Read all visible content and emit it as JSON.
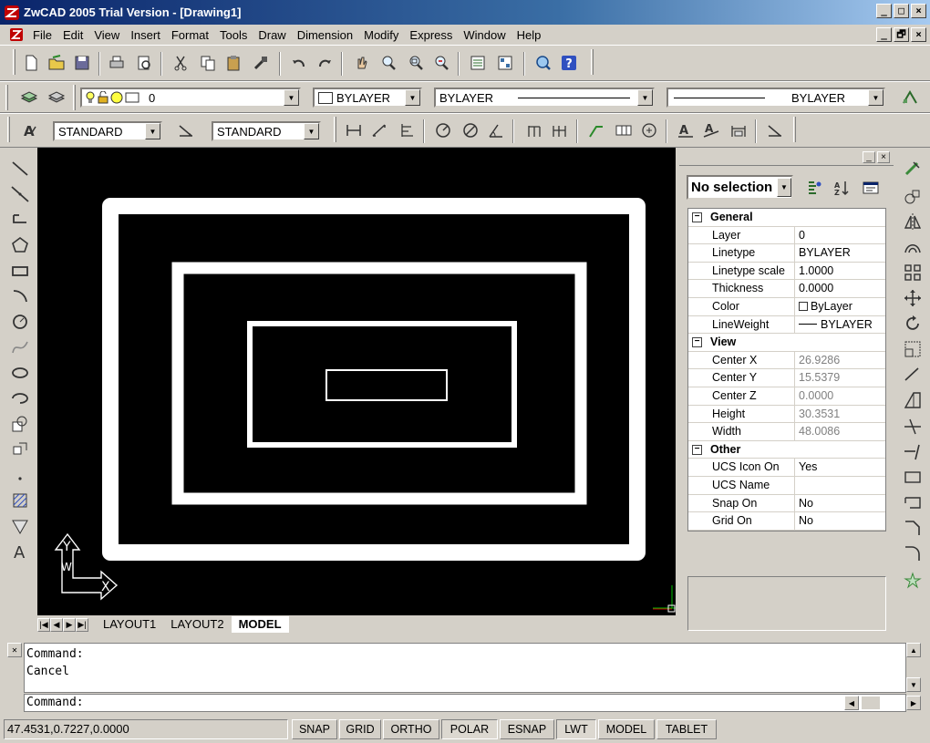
{
  "window": {
    "title": "ZwCAD 2005 Trial Version - [Drawing1]",
    "controls": [
      "_",
      "□",
      "×"
    ],
    "doc_controls": [
      "_",
      "🗗",
      "×"
    ]
  },
  "menu": [
    "File",
    "Edit",
    "View",
    "Insert",
    "Format",
    "Tools",
    "Draw",
    "Dimension",
    "Modify",
    "Express",
    "Window",
    "Help"
  ],
  "layer_toolbar": {
    "layer_value": "0",
    "color_value": "BYLAYER",
    "linetype_value": "BYLAYER",
    "lineweight_value": "BYLAYER"
  },
  "style_toolbar": {
    "text_style": "STANDARD",
    "dim_style": "STANDARD"
  },
  "properties": {
    "selection": "No selection",
    "panel_controls": [
      "_",
      "×"
    ],
    "categories": [
      {
        "name": "General",
        "toggle": "−",
        "rows": [
          {
            "key": "Layer",
            "value": "0"
          },
          {
            "key": "Linetype",
            "value": "BYLAYER"
          },
          {
            "key": "Linetype scale",
            "value": "1.0000"
          },
          {
            "key": "Thickness",
            "value": "0.0000"
          },
          {
            "key": "Color",
            "value": "ByLayer"
          },
          {
            "key": "LineWeight",
            "value": "BYLAYER"
          }
        ]
      },
      {
        "name": "View",
        "toggle": "−",
        "rows": [
          {
            "key": "Center X",
            "value": "26.9286"
          },
          {
            "key": "Center Y",
            "value": "15.5379"
          },
          {
            "key": "Center Z",
            "value": "0.0000"
          },
          {
            "key": "Height",
            "value": "30.3531"
          },
          {
            "key": "Width",
            "value": "48.0086"
          }
        ]
      },
      {
        "name": "Other",
        "toggle": "−",
        "rows": [
          {
            "key": "UCS Icon On",
            "value": "Yes"
          },
          {
            "key": "UCS Name",
            "value": ""
          },
          {
            "key": "Snap On",
            "value": "No"
          },
          {
            "key": "Grid On",
            "value": "No"
          }
        ]
      }
    ]
  },
  "ucs_icon": {
    "x_label": "X",
    "y_label": "Y",
    "w_label": "W"
  },
  "layout_tabs": [
    {
      "label": "LAYOUT1",
      "active": false
    },
    {
      "label": "LAYOUT2",
      "active": false
    },
    {
      "label": "MODEL",
      "active": true
    }
  ],
  "command": {
    "history": [
      "Command:",
      "Cancel"
    ],
    "prompt": "Command:"
  },
  "status": {
    "coordinates": "47.4531,0.7227,0.0000",
    "buttons": [
      {
        "label": "SNAP",
        "on": false
      },
      {
        "label": "GRID",
        "on": false
      },
      {
        "label": "ORTHO",
        "on": false
      },
      {
        "label": "POLAR",
        "on": true
      },
      {
        "label": "ESNAP",
        "on": false
      },
      {
        "label": "LWT",
        "on": true
      },
      {
        "label": "MODEL",
        "on": false
      },
      {
        "label": "TABLET",
        "on": false
      }
    ]
  },
  "colors": {
    "title_bar": "#0a246a",
    "canvas": "#000000",
    "chrome": "#d4d0c8",
    "drawing_lines": "#ffffff"
  }
}
